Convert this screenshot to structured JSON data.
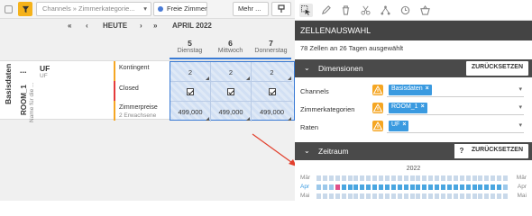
{
  "toolbar": {
    "filter_select": "Channels » Zimmerkategorie...",
    "free_rooms": "Freie Zimmer",
    "more": "Mehr ..."
  },
  "nav": {
    "prev2": "«",
    "prev": "‹",
    "today": "HEUTE",
    "next": "›",
    "next2": "»",
    "month": "APRIL 2022"
  },
  "days": [
    {
      "num": "5",
      "name": "Dienstag"
    },
    {
      "num": "6",
      "name": "Mittwoch"
    },
    {
      "num": "7",
      "name": "Donnerstag"
    }
  ],
  "row_group": {
    "basis": "Basisdaten",
    "room": "ROOM_1",
    "room_sub": "Name für die ...",
    "dots": "...",
    "uf": "UF",
    "uf_sub": "UF"
  },
  "row_labels": {
    "kontingent": "Kontingent",
    "closed": "Closed",
    "zimmerpreise": "Zimmerpreise",
    "zimmerpreise_sub": "2 Erwachsene"
  },
  "cells": {
    "kontingent": [
      "2",
      "2",
      "2"
    ],
    "closed": [
      true,
      true,
      true
    ],
    "preise": [
      "499,000",
      "499,000",
      "499,000"
    ]
  },
  "panel": {
    "title": "ZELLENAUSWAHL",
    "count": "78 Zellen an 26 Tagen ausgewählt",
    "dimensionen": "Dimensionen",
    "reset": "ZURÜCKSETZEN",
    "zeitraum": "Zeitraum",
    "help": "?",
    "filters": [
      {
        "label": "Channels",
        "tag": "Basisdaten"
      },
      {
        "label": "Zimmerkategorien",
        "tag": "ROOM_1"
      },
      {
        "label": "Raten",
        "tag": "UF"
      }
    ],
    "year": "2022",
    "months": [
      "Mär",
      "Apr",
      "Mai"
    ]
  },
  "colors": {
    "accent": "#3a7bd5",
    "tag": "#3a9ae0",
    "warning": "#f5a623",
    "filter": "#f5b21a",
    "header": "#444444"
  }
}
